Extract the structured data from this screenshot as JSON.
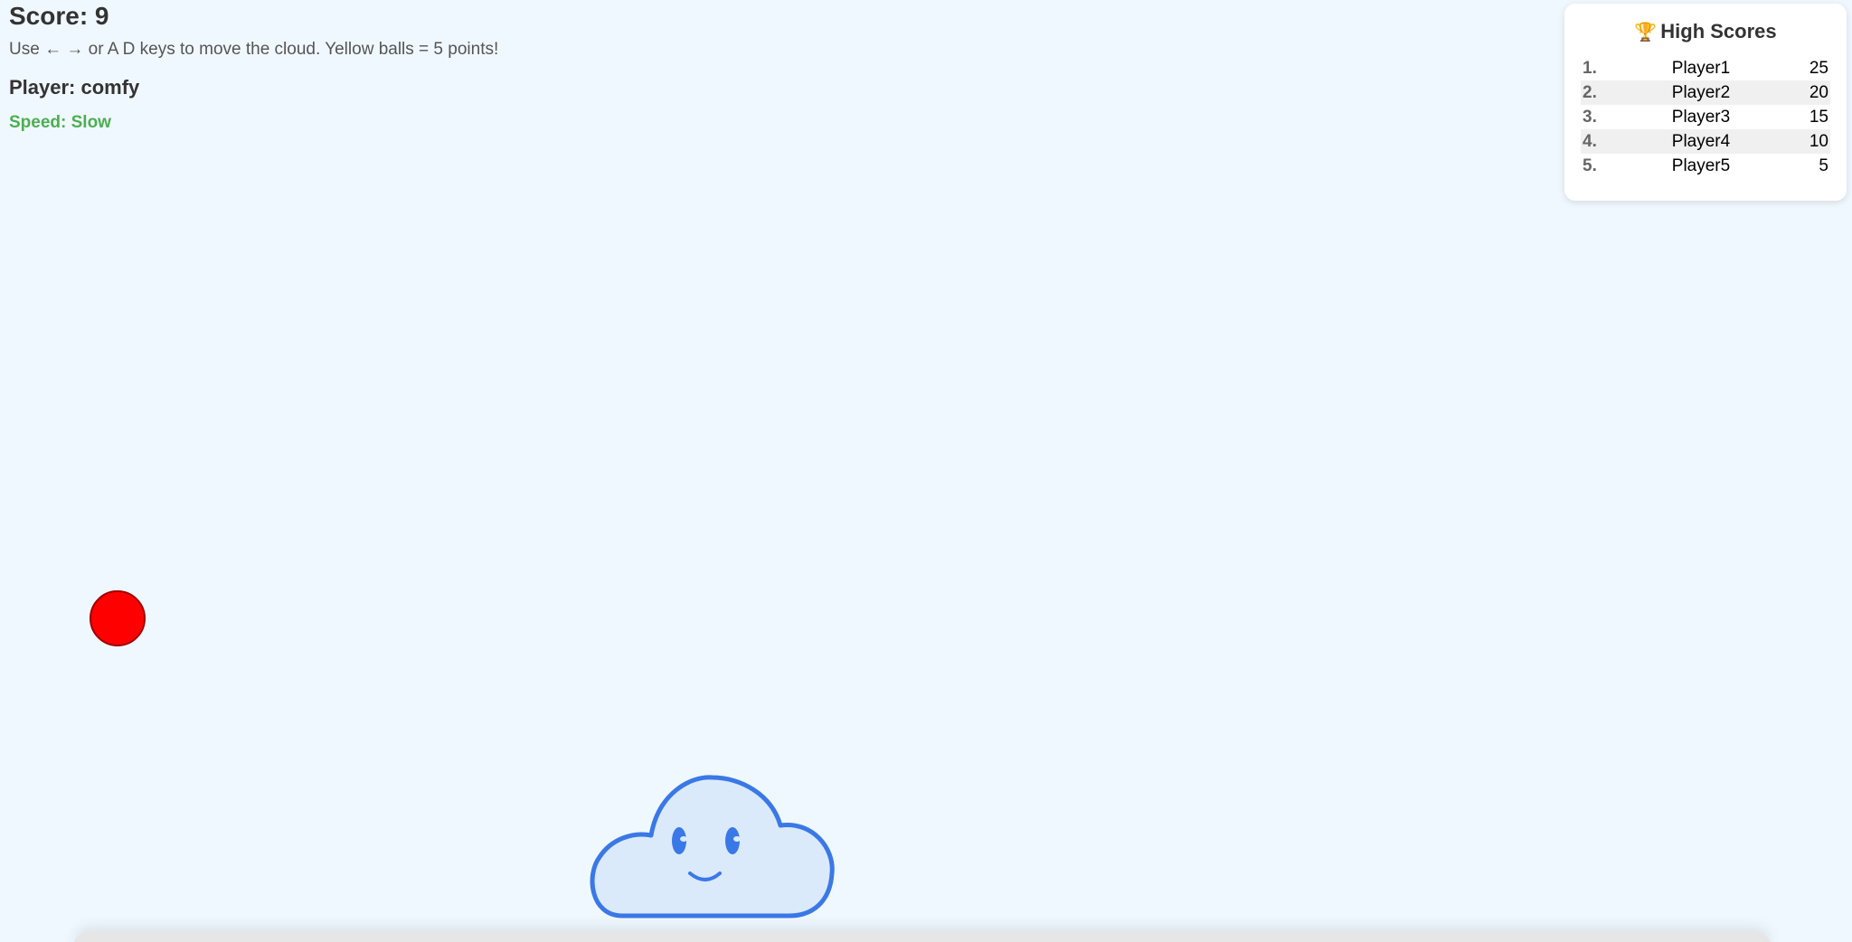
{
  "hud": {
    "score": "Score: 9",
    "instructions": "Use ← → or A D keys to move the cloud. Yellow balls = 5 points!",
    "player": "Player: comfy",
    "speed": "Speed: Slow"
  },
  "high_scores": {
    "title": "High Scores",
    "icon": "trophy-icon",
    "entries": [
      {
        "rank": "1.",
        "name": "Player1",
        "score": "25"
      },
      {
        "rank": "2.",
        "name": "Player2",
        "score": "20"
      },
      {
        "rank": "3.",
        "name": "Player3",
        "score": "15"
      },
      {
        "rank": "4.",
        "name": "Player4",
        "score": "10"
      },
      {
        "rank": "5.",
        "name": "Player5",
        "score": "5"
      }
    ]
  },
  "colors": {
    "background": "#f0f8ff",
    "speed_text": "#4caf50",
    "ball": "#ff0000",
    "cloud_stroke": "#3b78e7",
    "cloud_fill": "#dbeafb"
  }
}
